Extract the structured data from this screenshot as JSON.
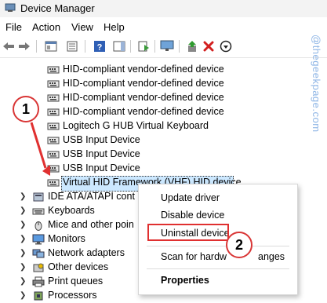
{
  "window": {
    "title": "Device Manager"
  },
  "menu": [
    "File",
    "Action",
    "View",
    "Help"
  ],
  "tree_items": [
    {
      "label": "HID-compliant vendor-defined device",
      "icon": "hid-device-icon"
    },
    {
      "label": "HID-compliant vendor-defined device",
      "icon": "hid-device-icon"
    },
    {
      "label": "HID-compliant vendor-defined device",
      "icon": "hid-device-icon"
    },
    {
      "label": "HID-compliant vendor-defined device",
      "icon": "hid-device-icon"
    },
    {
      "label": "Logitech G HUB Virtual Keyboard",
      "icon": "hid-device-icon"
    },
    {
      "label": "USB Input Device",
      "icon": "hid-device-icon"
    },
    {
      "label": "USB Input Device",
      "icon": "hid-device-icon"
    },
    {
      "label": "USB Input Device",
      "icon": "hid-device-icon"
    },
    {
      "label": "Virtual HID Framework (VHF) HID device",
      "icon": "hid-device-icon",
      "selected": true
    }
  ],
  "categories": [
    {
      "label": "IDE ATA/ATAPI cont",
      "icon": "ide-controller-icon"
    },
    {
      "label": "Keyboards",
      "icon": "keyboard-icon"
    },
    {
      "label": "Mice and other poin",
      "icon": "mouse-icon"
    },
    {
      "label": "Monitors",
      "icon": "monitor-icon"
    },
    {
      "label": "Network adapters",
      "icon": "network-adapter-icon"
    },
    {
      "label": "Other devices",
      "icon": "other-devices-icon"
    },
    {
      "label": "Print queues",
      "icon": "printer-icon"
    },
    {
      "label": "Processors",
      "icon": "processor-icon"
    }
  ],
  "context_menu": {
    "items": [
      "Update driver",
      "Disable device",
      "Uninstall device",
      "Scan for hardw",
      "anges",
      "Properties"
    ]
  },
  "annotations": {
    "step1": "1",
    "step2": "2"
  },
  "watermark": "@thegeekpage.com",
  "colors": {
    "selection": "#cce8ff",
    "annotation_red": "#e03030"
  }
}
